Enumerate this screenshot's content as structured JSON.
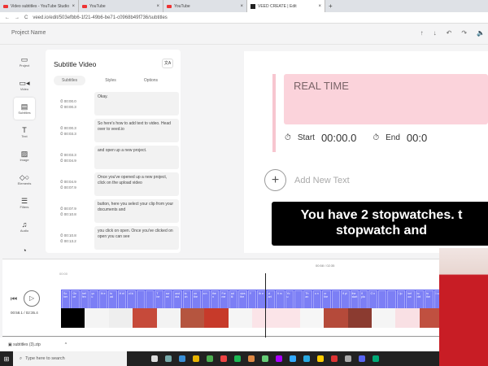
{
  "browser": {
    "tabs": [
      {
        "title": "Video subtitles - YouTube Studio",
        "icon": "youtube-icon"
      },
      {
        "title": "YouTube",
        "icon": "youtube-icon"
      },
      {
        "title": "YouTube",
        "icon": "youtube-icon"
      },
      {
        "title": "VEED CREATE | Edit",
        "icon": "veed-icon",
        "active": true
      }
    ],
    "new_tab": "+",
    "url": "veed.io/edit/503efbb6-1f21-49b6-be71-c0968b49f736/subtitles"
  },
  "header": {
    "project_name": "Project Name",
    "icons": [
      "arrow-up-icon",
      "arrow-down-icon",
      "undo-icon",
      "redo-icon",
      "volume-icon"
    ]
  },
  "sidebar": {
    "items": [
      {
        "label": "Project",
        "icon": "▭"
      },
      {
        "label": "Video",
        "icon": "▭◂"
      },
      {
        "label": "Subtitles",
        "icon": "▤",
        "active": true
      },
      {
        "label": "Text",
        "icon": "T"
      },
      {
        "label": "Image",
        "icon": "▨"
      },
      {
        "label": "Elements",
        "icon": "◇○"
      },
      {
        "label": "Filters",
        "icon": "☰"
      },
      {
        "label": "Audio",
        "icon": "♫"
      },
      {
        "label": "",
        "icon": "◔"
      }
    ]
  },
  "panel": {
    "title": "Subtitle Video",
    "translate_icon": "文A",
    "tabs": [
      "Subtitles",
      "Styles",
      "Options"
    ],
    "subtitles": [
      {
        "start": "00:00.0",
        "end": "00:00.3",
        "text": "Okay."
      },
      {
        "start": "00:00.3",
        "end": "00:03.3",
        "text": "So here's how to add text to video. Head over to veed.io"
      },
      {
        "start": "00:03.3",
        "end": "00:04.9",
        "text": "and open up a new project."
      },
      {
        "start": "00:04.9",
        "end": "00:07.9",
        "text": "Once you've opened up a new project, click on the upload video"
      },
      {
        "start": "00:07.9",
        "end": "00:10.8",
        "text": "button, here you select your clip from your documents and"
      },
      {
        "start": "00:10.8",
        "end": "00:13.2",
        "text": "you click on open. Once you've clicked on open you can see"
      }
    ]
  },
  "stage": {
    "text_value": "REAL TIME",
    "start_label": "Start",
    "start_time": "00:00.0",
    "end_label": "End",
    "end_time": "00:0",
    "add_new_text": "Add New Text",
    "caption_line1": "You have 2 stopwatches. t",
    "caption_line2": "stopwatch and"
  },
  "timeline": {
    "top_time": "00:58 / 02:35",
    "start_marker": "00:00",
    "current_time": "00:58.1 / 02:35.4",
    "chips": [
      "So her",
      "On ce",
      "bef fen",
      "yo u",
      "th e",
      "to ad",
      "H el",
      "cl ic",
      "",
      "",
      "T he",
      "scr ee",
      "and dra",
      "to ch",
      "on the",
      "a n",
      "the n",
      "For me",
      "ad iti",
      "size, the",
      "Y",
      "th e",
      "cl art",
      "fi m",
      "Yo u",
      "",
      "Th an",
      "o n",
      "or the",
      "",
      "if pl",
      "the start",
      "if pla",
      "O n",
      "",
      "",
      "I ju",
      "bef ow",
      "to del",
      "to the",
      "I ca"
    ],
    "accent": "#6366f1"
  },
  "downloads": {
    "file": "subtitles (3).zip",
    "chevron": "^"
  },
  "taskbar": {
    "search_placeholder": "Type here to search"
  }
}
